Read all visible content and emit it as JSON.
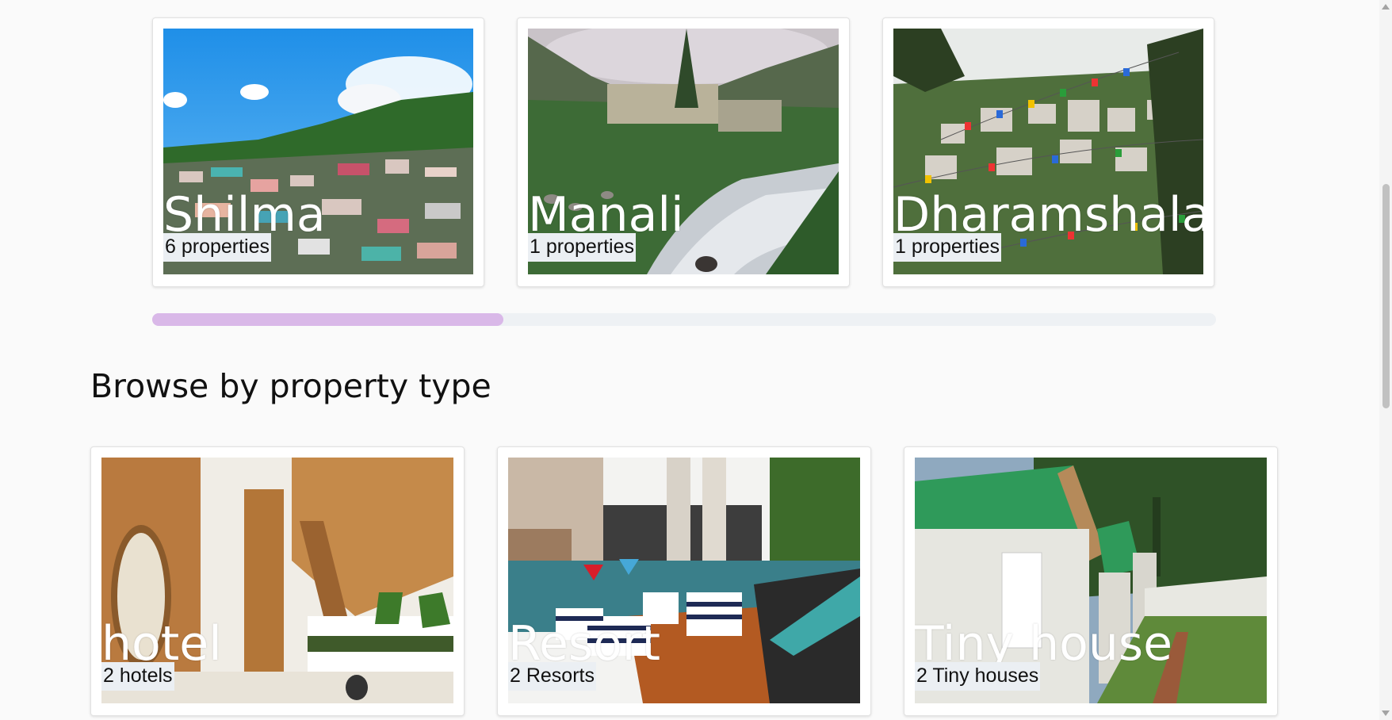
{
  "cities": [
    {
      "name": "Shilma",
      "count": "6 properties",
      "image": "hillside-town-photo"
    },
    {
      "name": "Manali",
      "count": "1 properties",
      "image": "river-valley-photo"
    },
    {
      "name": "Dharamshala",
      "count": "1 properties",
      "image": "prayer-flags-town-photo"
    }
  ],
  "carousel": {
    "scroll_fraction": 0.33
  },
  "section": {
    "heading": "Browse by property type"
  },
  "property_types": [
    {
      "name": "hotel",
      "count": "2 hotels",
      "image": "hotel-room-photo"
    },
    {
      "name": "Resort",
      "count": "2 Resorts",
      "image": "resort-pool-photo"
    },
    {
      "name": "Tiny house",
      "count": "2 Tiny houses",
      "image": "cottages-photo"
    }
  ],
  "colors": {
    "scroll_thumb": "#d9b8e8",
    "count_badge": "#ebeff3",
    "background": "#fafafa"
  }
}
